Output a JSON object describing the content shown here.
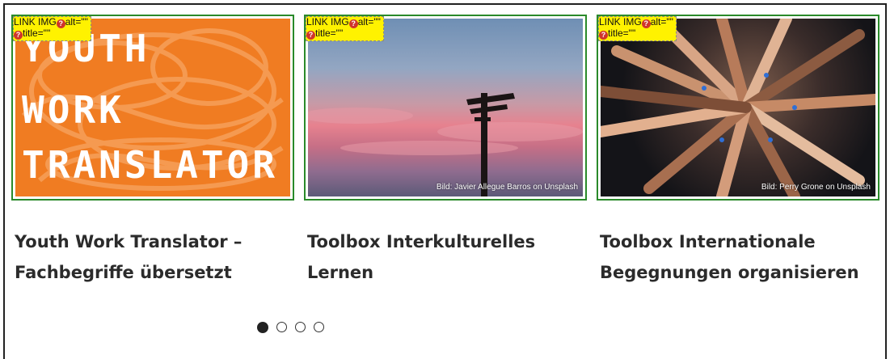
{
  "debug_badge": {
    "line1": "LINK IMG",
    "alt": "alt=\"\"",
    "title": "title=\"\""
  },
  "cards": [
    {
      "image_text": [
        "YOUTH",
        "WORK",
        "TRANSLATOR"
      ],
      "credit": "",
      "title_line1": "Youth Work Translator –",
      "title_line2": "Fachbegriffe übersetzt"
    },
    {
      "image_text": [],
      "credit": "Bild: Javier Allegue Barros on Unsplash",
      "title_line1": "Toolbox Interkulturelles",
      "title_line2": "Lernen"
    },
    {
      "image_text": [],
      "credit": "Bild: Perry Grone on Unsplash",
      "title_line1": "Toolbox Internationale",
      "title_line2": "Begegnungen organisieren"
    }
  ],
  "carousel": {
    "dot_count": 4,
    "active_index": 0
  },
  "colors": {
    "card_border": "#2a8a2a",
    "badge_bg": "#fff200",
    "badge_icon": "#d0352b",
    "orange": "#f07c22"
  }
}
